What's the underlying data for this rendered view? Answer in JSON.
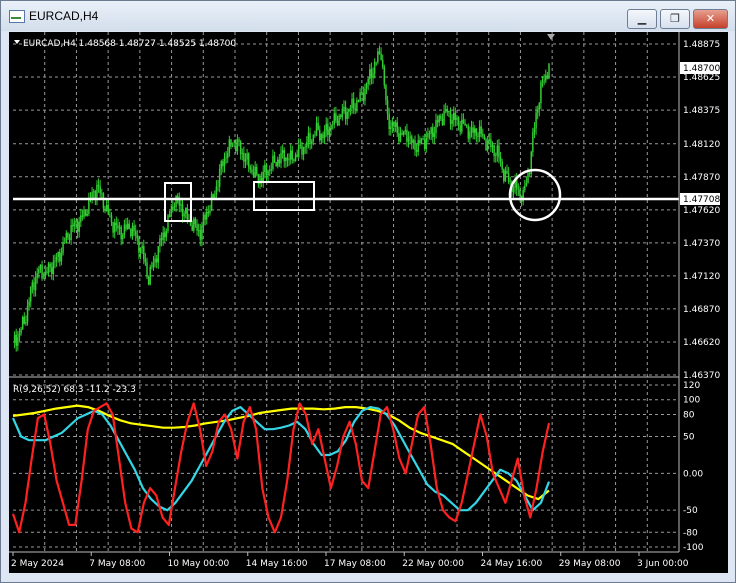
{
  "window": {
    "title": "EURCAD,H4",
    "minimize_glyph": "▁",
    "maximize_glyph": "❐",
    "close_glyph": "✕"
  },
  "chart": {
    "header": "EURCAD,H4  1.48568 1.48727 1.48525 1.48700",
    "current_price": "1.48700",
    "level_price": "1.47708",
    "indicator_label": "R(9,26,52) 68.3 -11.2 -23.3",
    "colors": {
      "background": "#000000",
      "candles": "#32cd32",
      "grid": "#9a9a9a",
      "level": "#ffffff",
      "fast": "#ff2020",
      "medium": "#33d6e6",
      "slow": "#ffff00"
    }
  },
  "chart_data": [
    {
      "type": "candlestick",
      "title": "EURCAD,H4",
      "ohlc_last": {
        "open": 1.48568,
        "high": 1.48727,
        "low": 1.48525,
        "close": 1.487
      },
      "y_ticks": [
        "1.48875",
        "1.48625",
        "1.48375",
        "1.48120",
        "1.47870",
        "1.47620",
        "1.47370",
        "1.47120",
        "1.46870",
        "1.46620",
        "1.46370"
      ],
      "ylim": [
        1.4637,
        1.48875
      ],
      "x_ticks": [
        "2 May 2024",
        "7 May 08:00",
        "10 May 00:00",
        "14 May 16:00",
        "17 May 08:00",
        "22 May 00:00",
        "24 May 16:00",
        "29 May 08:00",
        "3 Jun 00:00"
      ],
      "horizontal_level": 1.47708,
      "close_series": [
        1.4662,
        1.4668,
        1.4682,
        1.4705,
        1.4716,
        1.4713,
        1.472,
        1.4726,
        1.4737,
        1.4748,
        1.4752,
        1.4758,
        1.477,
        1.478,
        1.4768,
        1.4755,
        1.4748,
        1.4745,
        1.475,
        1.4742,
        1.473,
        1.471,
        1.4725,
        1.474,
        1.4752,
        1.477,
        1.4765,
        1.4755,
        1.475,
        1.4745,
        1.476,
        1.477,
        1.479,
        1.4805,
        1.4812,
        1.481,
        1.48,
        1.4792,
        1.4785,
        1.479,
        1.4795,
        1.48,
        1.4803,
        1.48,
        1.4805,
        1.481,
        1.4815,
        1.4822,
        1.4818,
        1.4825,
        1.483,
        1.4835,
        1.4838,
        1.4842,
        1.4848,
        1.486,
        1.4872,
        1.4882,
        1.483,
        1.4825,
        1.4818,
        1.482,
        1.481,
        1.4812,
        1.4816,
        1.4822,
        1.483,
        1.4836,
        1.4832,
        1.4828,
        1.4825,
        1.482,
        1.4822,
        1.4815,
        1.481,
        1.4805,
        1.479,
        1.4782,
        1.4778,
        1.4772,
        1.4795,
        1.4835,
        1.4858,
        1.487
      ]
    },
    {
      "type": "line",
      "title": "R(9,26,52) 68.3 -11.2 -23.3",
      "y_ticks": [
        "120",
        "100",
        "80",
        "50",
        "0.00",
        "-50",
        "-80",
        "-100"
      ],
      "ylim": [
        -100,
        120
      ],
      "series": [
        {
          "name": "",
          "values": [
            -55,
            -80,
            -40,
            20,
            75,
            80,
            40,
            -10,
            -40,
            -70,
            -70,
            -10,
            60,
            85,
            90,
            95,
            80,
            20,
            -40,
            -75,
            -80,
            -40,
            -20,
            -30,
            -60,
            -70,
            -20,
            30,
            70,
            95,
            60,
            10,
            30,
            70,
            80,
            60,
            20,
            70,
            90,
            60,
            -20,
            -60,
            -80,
            -60,
            -10,
            60,
            95,
            80,
            40,
            60,
            20,
            -20,
            10,
            50,
            70,
            40,
            -10,
            -20,
            30,
            80,
            90,
            60,
            20,
            0,
            40,
            80,
            90,
            40,
            -20,
            -50,
            -60,
            -65,
            -40,
            0,
            40,
            80,
            50,
            0,
            -20,
            -40,
            -10,
            20,
            -30,
            -60,
            -20,
            30,
            68.3
          ]
        },
        {
          "name": "",
          "values": [
            75,
            50,
            45,
            45,
            45,
            50,
            55,
            65,
            75,
            80,
            85,
            80,
            65,
            45,
            25,
            5,
            -20,
            -35,
            -45,
            -50,
            -40,
            -25,
            -10,
            10,
            30,
            50,
            70,
            85,
            90,
            80,
            70,
            60,
            60,
            62,
            65,
            70,
            60,
            40,
            25,
            25,
            30,
            45,
            70,
            85,
            90,
            88,
            80,
            65,
            45,
            25,
            5,
            -15,
            -25,
            -30,
            -40,
            -50,
            -50,
            -40,
            -25,
            -10,
            5,
            0,
            -10,
            -30,
            -50,
            -40,
            -11.2
          ]
        },
        {
          "name": "",
          "values": [
            78,
            80,
            82,
            85,
            88,
            90,
            92,
            90,
            85,
            78,
            72,
            68,
            66,
            64,
            62,
            62,
            63,
            65,
            68,
            70,
            72,
            75,
            78,
            82,
            84,
            86,
            88,
            88,
            88,
            87,
            88,
            90,
            90,
            88,
            85,
            80,
            72,
            62,
            55,
            50,
            45,
            40,
            30,
            20,
            10,
            0,
            -10,
            -20,
            -30,
            -35,
            -23.3
          ]
        }
      ]
    }
  ]
}
